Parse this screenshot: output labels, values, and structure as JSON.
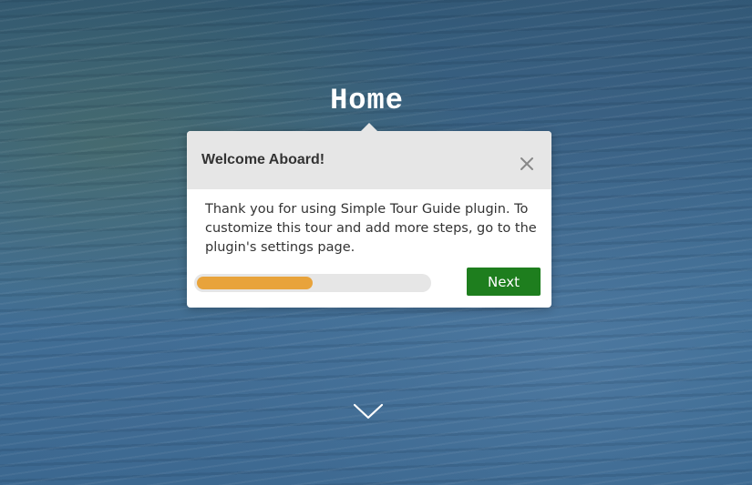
{
  "page": {
    "title": "Home"
  },
  "tour": {
    "title": "Welcome Aboard!",
    "message": "Thank you for using Simple Tour Guide plugin. To customize this tour and add more steps, go to the plugin's settings page.",
    "next_label": "Next",
    "progress_fraction": 0.5,
    "close_icon": "close-icon"
  },
  "scroll_icon": "chevron-down-icon",
  "colors": {
    "header_bg": "#e6e6e6",
    "progress_fill": "#e8a33b",
    "progress_track": "#e6e6e6",
    "next_button": "#1e7e1e",
    "title_text": "#ffffff"
  }
}
